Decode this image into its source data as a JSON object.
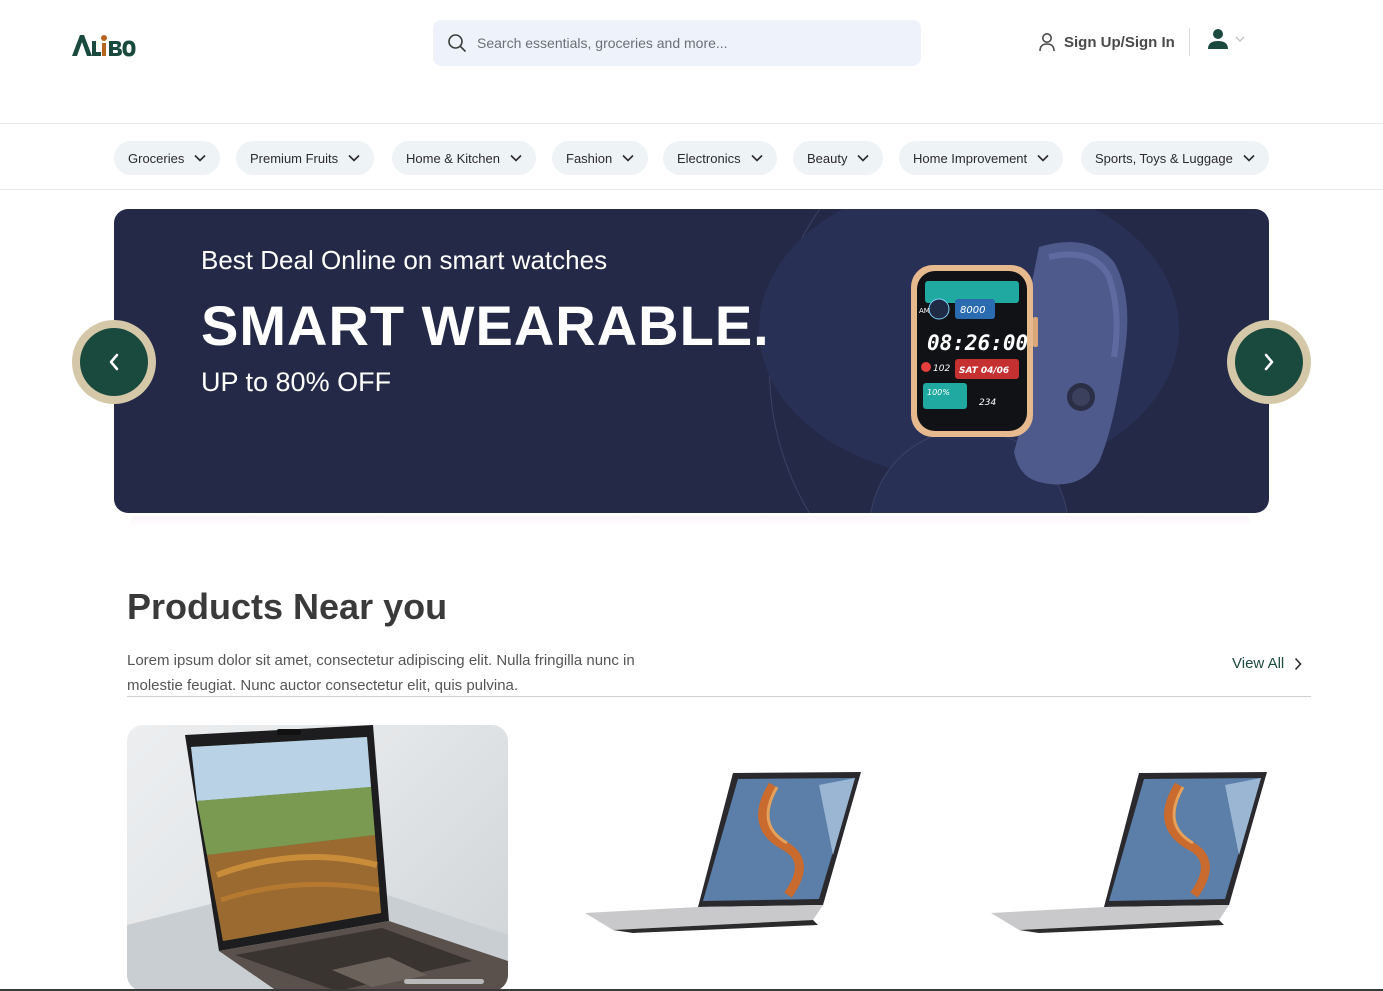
{
  "brand": {
    "logo_text": "ALiBO",
    "primary_color": "#1a4a3e",
    "accent_color": "#b5651d"
  },
  "search": {
    "placeholder": "Search essentials, groceries and more..."
  },
  "header": {
    "signin_label": "Sign Up/Sign In"
  },
  "categories": [
    {
      "label": "Groceries"
    },
    {
      "label": "Premium Fruits"
    },
    {
      "label": "Home & Kitchen"
    },
    {
      "label": "Fashion"
    },
    {
      "label": "Electronics"
    },
    {
      "label": "Beauty"
    },
    {
      "label": "Home Improvement"
    },
    {
      "label": "Sports, Toys & Luggage"
    }
  ],
  "hero": {
    "subtitle": "Best Deal Online on smart watches",
    "title": "SMART WEARABLE.",
    "offer": "UP to 80% OFF",
    "background_color": "#232946",
    "watch": {
      "time": "08:26:00",
      "steps": "8000",
      "date": "SAT 04/06",
      "heart": "102",
      "battery": "100%",
      "calories": "234",
      "period": "AM"
    }
  },
  "products_section": {
    "title": "Products Near you",
    "description": "Lorem ipsum dolor sit amet, consectetur adipiscing elit. Nulla fringilla nunc in molestie feugiat. Nunc auctor consectetur elit, quis pulvina.",
    "view_all_label": "View All",
    "products": [
      {
        "image": "laptop-landscape-photo"
      },
      {
        "image": "laptop-abstract-wallpaper"
      },
      {
        "image": "laptop-abstract-wallpaper"
      }
    ]
  }
}
